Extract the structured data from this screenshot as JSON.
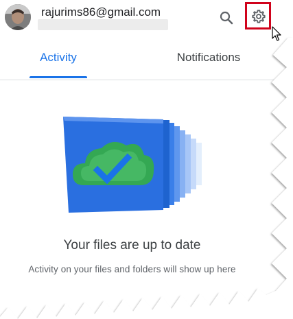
{
  "account": {
    "email": "rajurims86@gmail.com",
    "secondary_line": ""
  },
  "header": {
    "search_icon": "search-icon",
    "settings_icon": "gear-icon",
    "highlight_color": "#d0021b"
  },
  "tabs": [
    {
      "label": "Activity",
      "selected": true
    },
    {
      "label": "Notifications",
      "selected": false
    }
  ],
  "empty_state": {
    "illustration": "cloud-check-icon",
    "title": "Your files are up to date",
    "subtitle": "Activity on your files and folders will show up here"
  },
  "colors": {
    "accent": "#1a73e8",
    "cloud_green": "#34a853",
    "card_blue": "#1a73e8"
  }
}
